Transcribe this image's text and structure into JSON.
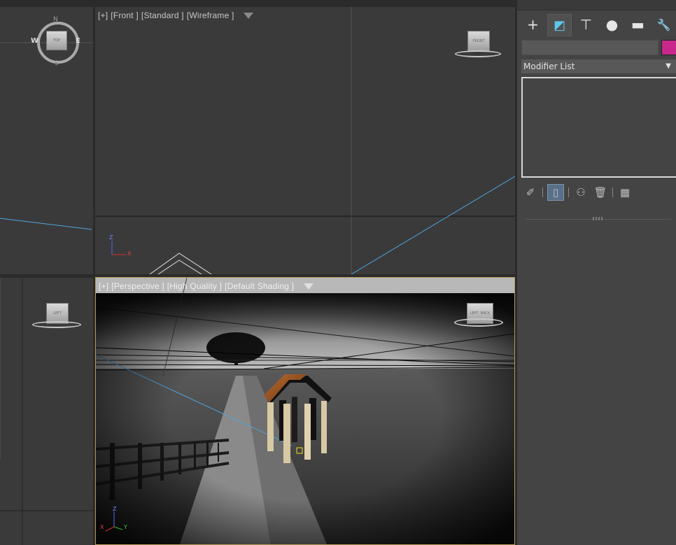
{
  "viewports": {
    "top": {
      "compass": {
        "n": "N",
        "s": "S",
        "e": "E",
        "w": "W"
      },
      "cube_label": "TOP"
    },
    "front": {
      "label_parts": [
        "[+]",
        "[Front ]",
        "[Standard ]",
        "[Wireframe ]"
      ],
      "cube_label": "FRONT",
      "axis_z": "Z",
      "axis_x": "X"
    },
    "left": {
      "cube_label": "LEFT"
    },
    "perspective": {
      "label_parts": [
        "[+]",
        "[Perspective ]",
        "[High Quality ]",
        "[Default Shading ]"
      ],
      "cube_label_left": "LEFT",
      "cube_label_right": "BACK",
      "axis_z": "Z",
      "axis_x": "X",
      "axis_y": "Y",
      "active_border_color": "#b49a55"
    }
  },
  "command_panel": {
    "tabs": [
      {
        "name": "create",
        "icon": "plus-icon",
        "glyph": "+"
      },
      {
        "name": "modify",
        "icon": "modify-icon",
        "glyph": "◩",
        "active": true
      },
      {
        "name": "hierarchy",
        "icon": "hierarchy-icon",
        "glyph": "⊤"
      },
      {
        "name": "motion",
        "icon": "motion-icon",
        "glyph": "●"
      },
      {
        "name": "display",
        "icon": "display-icon",
        "glyph": "▬"
      },
      {
        "name": "utilities",
        "icon": "wrench-icon",
        "glyph": "🔧"
      }
    ],
    "object_color": "#c8288c",
    "modifier_list_label": "Modifier List",
    "stack_tools": [
      {
        "name": "pin-stack",
        "icon": "pin-icon",
        "glyph": "✐"
      },
      {
        "name": "show-end-result",
        "icon": "end-result-icon",
        "glyph": "▯",
        "active": true
      },
      {
        "name": "make-unique",
        "icon": "make-unique-icon",
        "glyph": "⚇"
      },
      {
        "name": "remove-modifier",
        "icon": "trash-icon",
        "glyph": "🗑"
      },
      {
        "name": "configure-sets",
        "icon": "configure-icon",
        "glyph": "▦"
      }
    ]
  }
}
